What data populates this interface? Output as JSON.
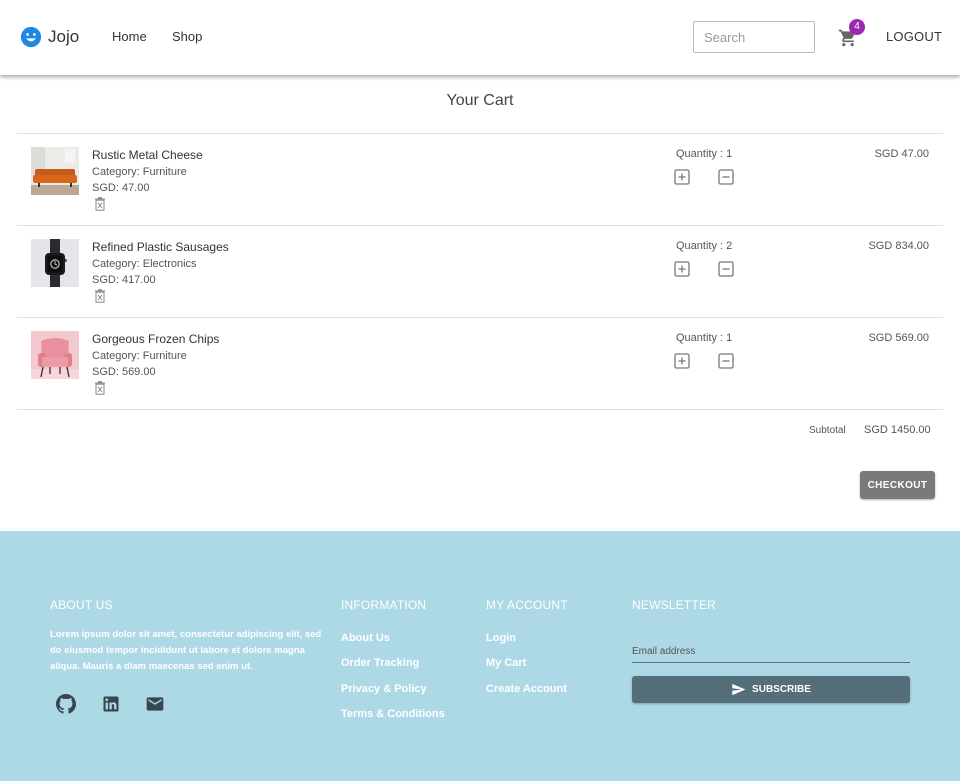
{
  "header": {
    "brand": "Jojo",
    "nav": [
      "Home",
      "Shop"
    ],
    "search_placeholder": "Search",
    "cart_count": "4",
    "logout_label": "LOGOUT"
  },
  "cart": {
    "title": "Your Cart",
    "items": [
      {
        "name": "Rustic Metal Cheese",
        "category": "Category: Furniture",
        "price": "SGD: 47.00",
        "quantity": "Quantity : 1",
        "total": "SGD 47.00",
        "image": "orange-sofa"
      },
      {
        "name": "Refined Plastic Sausages",
        "category": "Category: Electronics",
        "price": "SGD: 417.00",
        "quantity": "Quantity : 2",
        "total": "SGD 834.00",
        "image": "smart-watch"
      },
      {
        "name": "Gorgeous Frozen Chips",
        "category": "Category: Furniture",
        "price": "SGD: 569.00",
        "quantity": "Quantity : 1",
        "total": "SGD 569.00",
        "image": "pink-armchair"
      }
    ],
    "subtotal_label": "Subtotal",
    "subtotal_value": "SGD 1450.00",
    "checkout_label": "CHECKOUT"
  },
  "footer": {
    "about": {
      "heading": "ABOUT US",
      "text": "Lorem ipsum dolor sit amet, consectetur adipiscing elit, sed do eiusmod tempor incididunt ut labore et dolore magna aliqua. Mauris a diam maecenas sed enim ut.",
      "social_icons": [
        "github-icon",
        "linkedin-icon",
        "mail-icon"
      ]
    },
    "information": {
      "heading": "INFORMATION",
      "links": [
        "About Us",
        "Order Tracking",
        "Privacy & Policy",
        "Terms & Conditions"
      ]
    },
    "account": {
      "heading": "MY ACCOUNT",
      "links": [
        "Login",
        "My Cart",
        "Create Account"
      ]
    },
    "newsletter": {
      "heading": "NEWSLETTER",
      "email_placeholder": "Email address",
      "subscribe_label": "SUBSCRIBE"
    }
  },
  "colors": {
    "brand_blue": "#1e88e5",
    "badge_purple": "#9c27b0",
    "footer_bg": "#add8e6",
    "subscribe_bg": "#546e7a",
    "checkout_bg": "#7a7a7a"
  }
}
